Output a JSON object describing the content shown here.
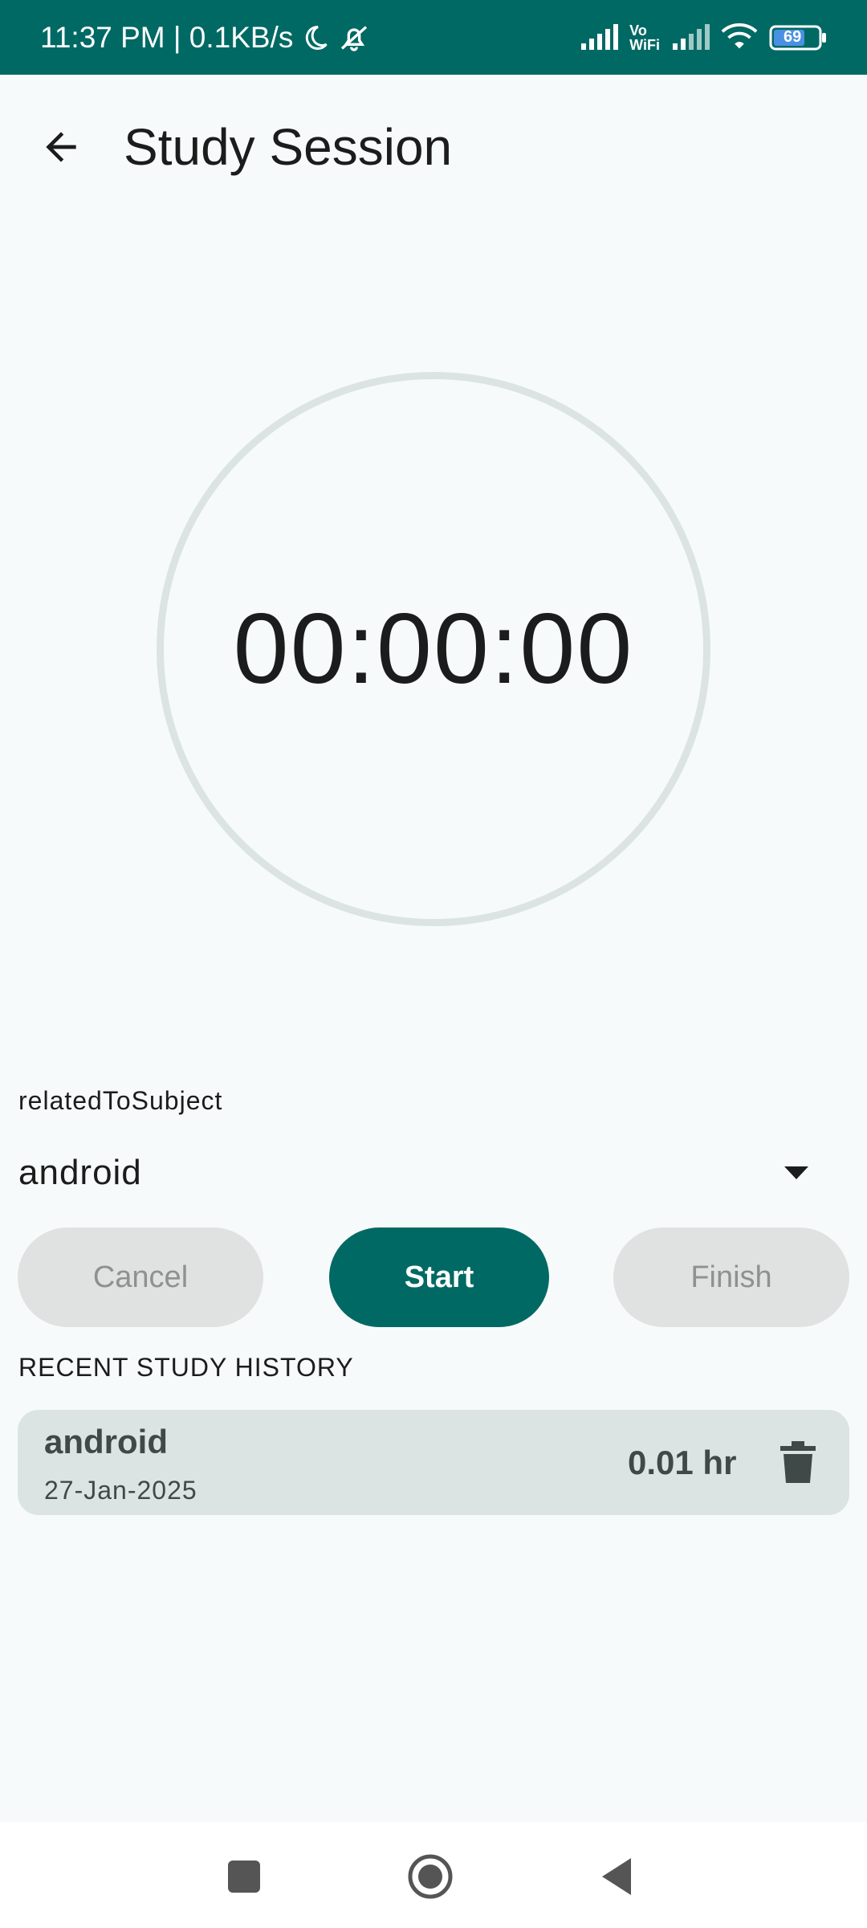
{
  "status_bar": {
    "time_speed": "11:37 PM | 0.1KB/s",
    "vowifi_top": "Vo",
    "vowifi_bottom": "WiFi",
    "battery": "69",
    "icons": [
      "moon-icon",
      "dnd-bell-off-icon",
      "signal-icon",
      "vowifi-icon",
      "signal-icon",
      "wifi-icon",
      "battery-icon"
    ]
  },
  "app_bar": {
    "title": "Study Session",
    "back_icon": "arrow-back-icon"
  },
  "timer": {
    "display": "00:00:00"
  },
  "subject": {
    "label": "relatedToSubject",
    "selected": "android",
    "dropdown_icon": "arrow-drop-down-icon"
  },
  "buttons": {
    "cancel": "Cancel",
    "start": "Start",
    "finish": "Finish"
  },
  "history": {
    "heading": "RECENT STUDY HISTORY",
    "items": [
      {
        "subject": "android",
        "date": "27-Jan-2025",
        "duration": "0.01 hr",
        "action_icon": "delete-icon"
      }
    ]
  },
  "colors": {
    "primary": "#016964",
    "background": "#f7fafa",
    "card": "#dbe4e3",
    "disabled_button": "#e0e2e1"
  },
  "nav_bar": {
    "icons": [
      "recents-square-icon",
      "home-circle-icon",
      "back-triangle-icon"
    ]
  }
}
